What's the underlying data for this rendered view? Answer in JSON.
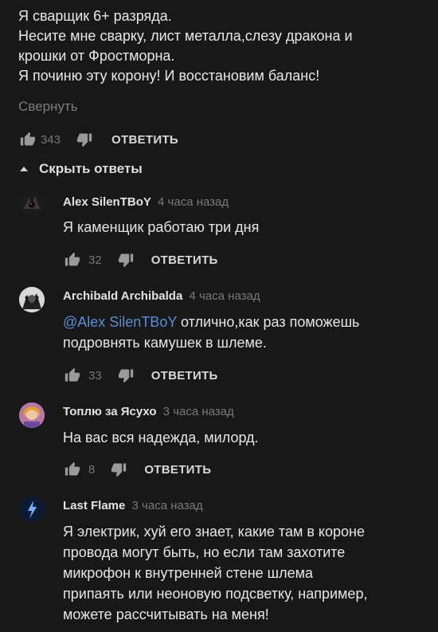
{
  "main_comment": {
    "lines": [
      "Я сварщик 6+ разряда.",
      "Несите мне сварку, лист металла,слезу дракона и",
      "крошки от Фростморна.",
      "Я починю эту корону! И восстановим баланс!"
    ],
    "collapse_label": "Свернуть",
    "likes": "343",
    "reply_label": "ОТВЕТИТЬ"
  },
  "hide_replies_label": "Скрыть ответы",
  "replies": [
    {
      "author": "Alex SilenTBoY",
      "time": "4 часа назад",
      "lines": [
        "Я каменщик работаю три дня"
      ],
      "likes": "32",
      "reply_label": "ОТВЕТИТЬ"
    },
    {
      "author": "Archibald Archibalda",
      "time": "4 часа назад",
      "mention": "@Alex SilenTBoY",
      "line1_rest": " отлично,как раз поможешь",
      "line2": "подровнять камушек в шлеме.",
      "likes": "33",
      "reply_label": "ОТВЕТИТЬ"
    },
    {
      "author": "Топлю за Ясухо",
      "time": "3 часа назад",
      "lines": [
        "На вас вся надежда, милорд."
      ],
      "likes": "8",
      "reply_label": "ОТВЕТИТЬ"
    },
    {
      "author": "Last Flame",
      "time": "3 часа назад",
      "lines": [
        "Я электрик, хуй его знает, какие там в короне",
        "провода могут быть, но если там захотите",
        "микрофон к внутренней стене шлема",
        "припаять или неоновую подсветку, например,",
        "можете рассчитывать на меня!"
      ]
    }
  ],
  "icons": {
    "like": "thumbs-up-icon",
    "dislike": "thumbs-down-icon",
    "caret": "caret-up-icon"
  },
  "colors": {
    "background": "#181818",
    "mention": "#5a8fd6",
    "muted": "#7a7a7a"
  }
}
